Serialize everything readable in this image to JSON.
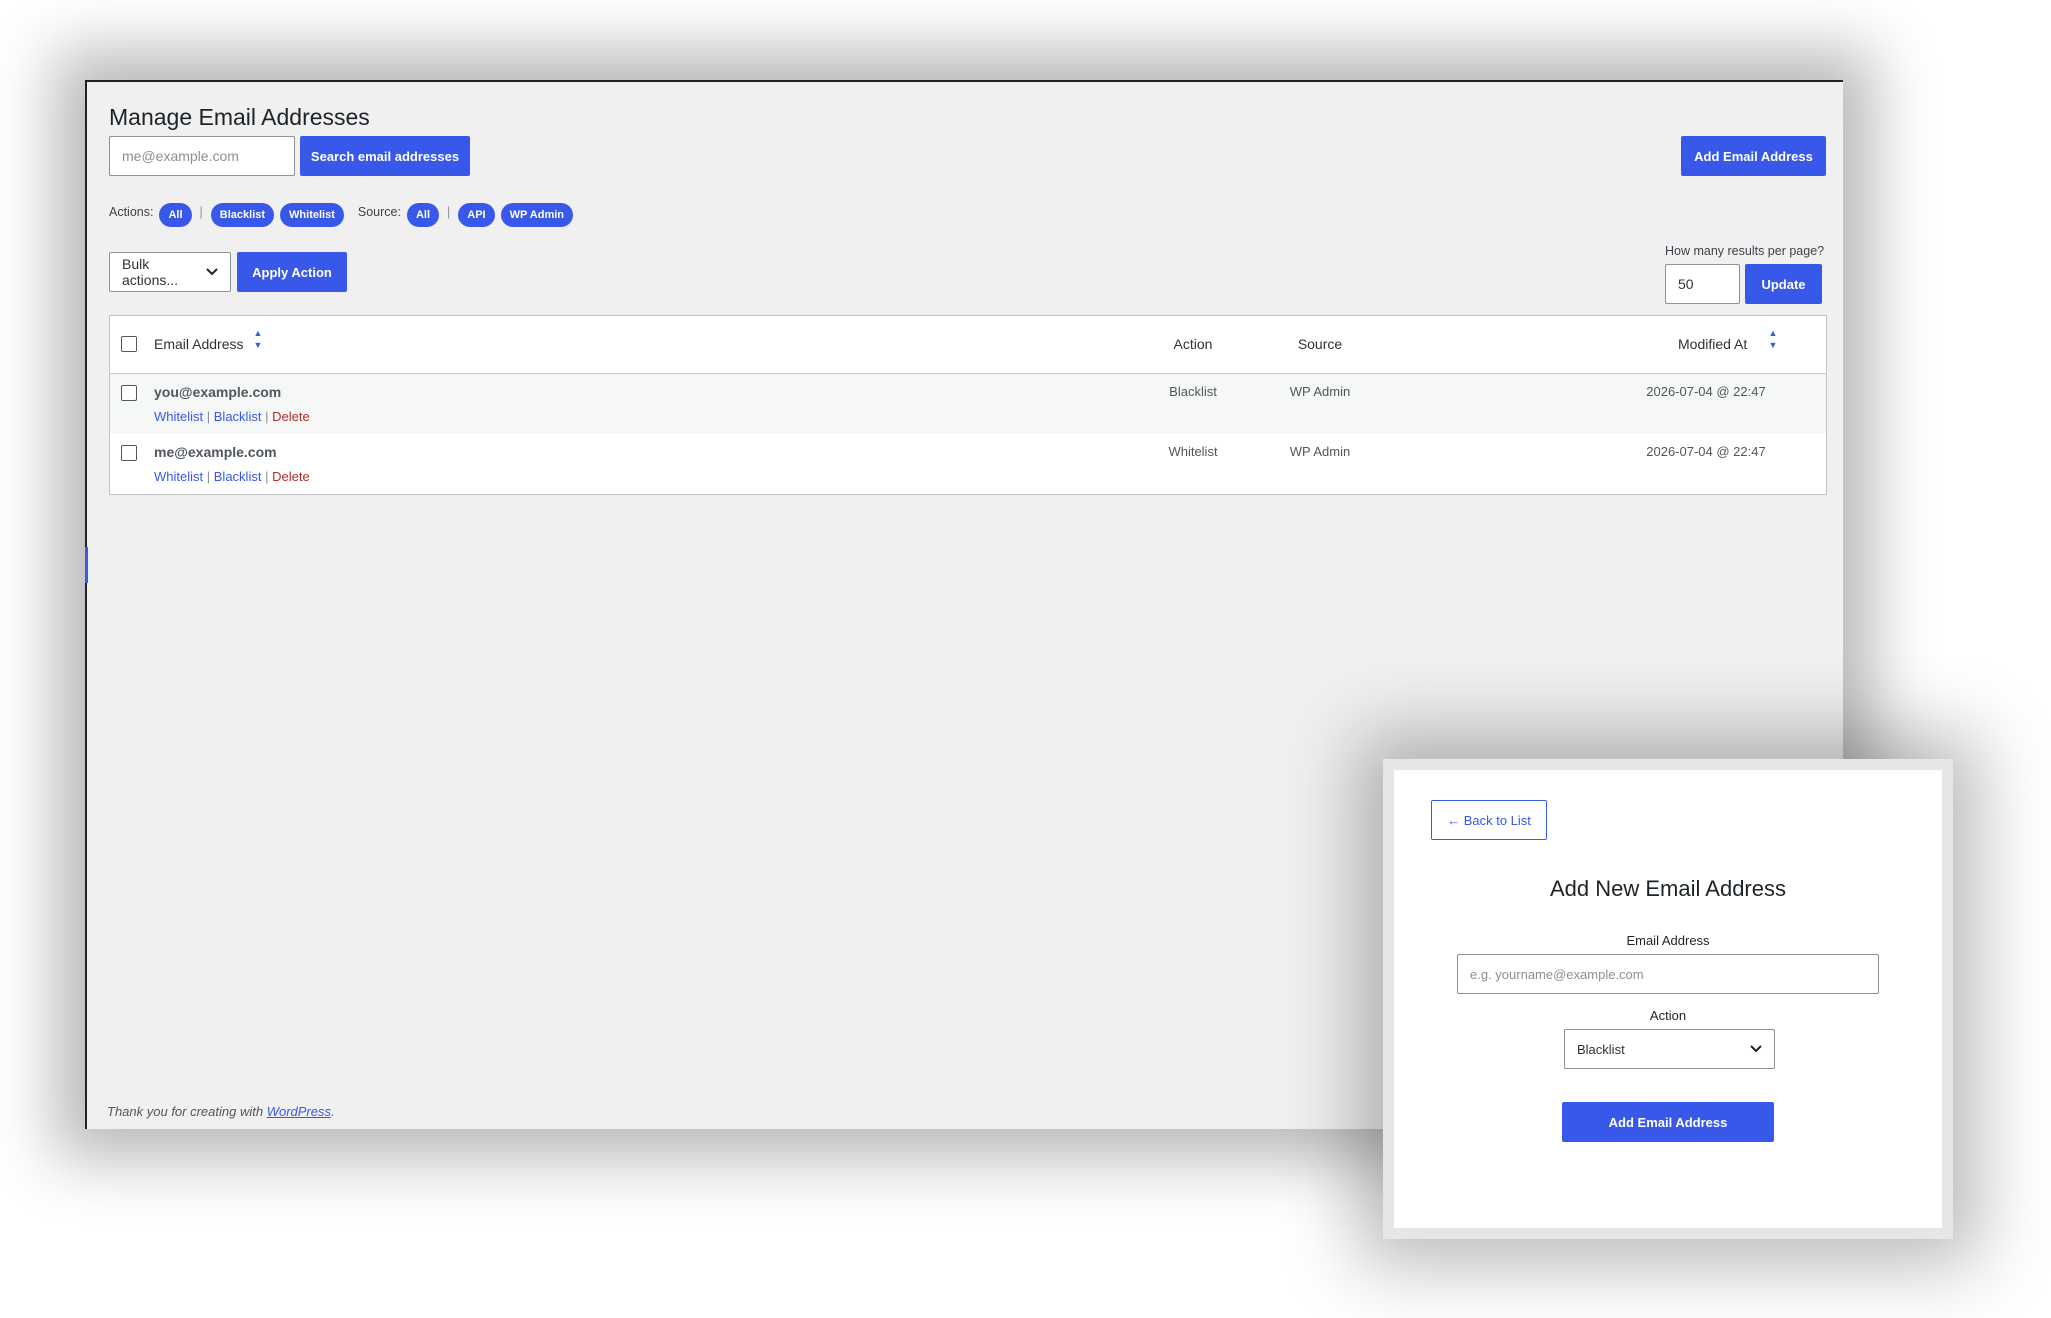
{
  "page": {
    "title": "Manage Email Addresses",
    "search": {
      "placeholder": "me@example.com",
      "button_label": "Search email addresses"
    },
    "add_button_label": "Add Email Address",
    "filters": {
      "actions_label": "Actions:",
      "actions": [
        "All",
        "Blacklist",
        "Whitelist"
      ],
      "source_label": "Source:",
      "sources": [
        "All",
        "API",
        "WP Admin"
      ],
      "separator": "|"
    },
    "bulk": {
      "selected": "Bulk actions...",
      "apply_label": "Apply Action"
    },
    "per_page": {
      "label": "How many results per page?",
      "value": "50",
      "update_label": "Update"
    }
  },
  "table": {
    "columns": {
      "email": "Email Address",
      "action": "Action",
      "source": "Source",
      "modified": "Modified At"
    },
    "row_actions": {
      "whitelist": "Whitelist",
      "blacklist": "Blacklist",
      "delete": "Delete",
      "separator": "|"
    },
    "rows": [
      {
        "email": "you@example.com",
        "action": "Blacklist",
        "source": "WP Admin",
        "modified": "2026-07-04 @ 22:47"
      },
      {
        "email": "me@example.com",
        "action": "Whitelist",
        "source": "WP Admin",
        "modified": "2026-07-04 @ 22:47"
      }
    ]
  },
  "footer": {
    "prefix": "Thank you for creating with ",
    "link": "WordPress",
    "suffix": "."
  },
  "modal": {
    "back_label": "← Back to List",
    "title": "Add New Email Address",
    "email_label": "Email Address",
    "email_placeholder": "e.g. yourname@example.com",
    "action_label": "Action",
    "action_selected": "Blacklist",
    "submit_label": "Add Email Address"
  },
  "icons": {
    "sort": "sort-arrows-icon",
    "dropdown": "chevron-down-icon"
  },
  "colors": {
    "accent": "#3858e9",
    "delete": "#b32d2e",
    "background": "#f0f0f1"
  }
}
